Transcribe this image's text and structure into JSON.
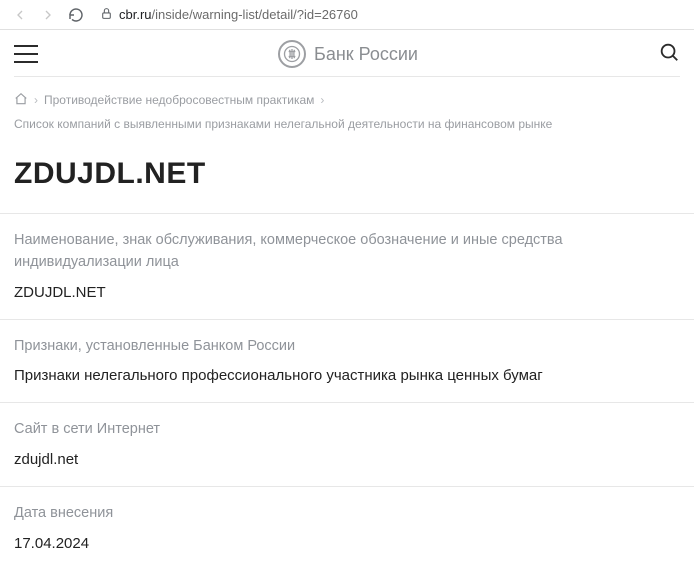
{
  "browser": {
    "url_domain": "cbr.ru",
    "url_path": "/inside/warning-list/detail/?id=26760"
  },
  "header": {
    "brand_name": "Банк России"
  },
  "breadcrumb": {
    "items": [
      "Противодействие недобросовестным практикам",
      "Список компаний с выявленными признаками нелегальной деятельности на финансовом рынке"
    ]
  },
  "page": {
    "title": "ZDUJDL.NET"
  },
  "details": [
    {
      "label": "Наименование, знак обслуживания, коммерческое обозначение и иные средства индивидуализации лица",
      "value": "ZDUJDL.NET"
    },
    {
      "label": "Признаки, установленные Банком России",
      "value": "Признаки нелегального профессионального участника рынка ценных бумаг"
    },
    {
      "label": "Сайт в сети Интернет",
      "value": "zdujdl.net"
    },
    {
      "label": "Дата внесения",
      "value": "17.04.2024"
    }
  ]
}
